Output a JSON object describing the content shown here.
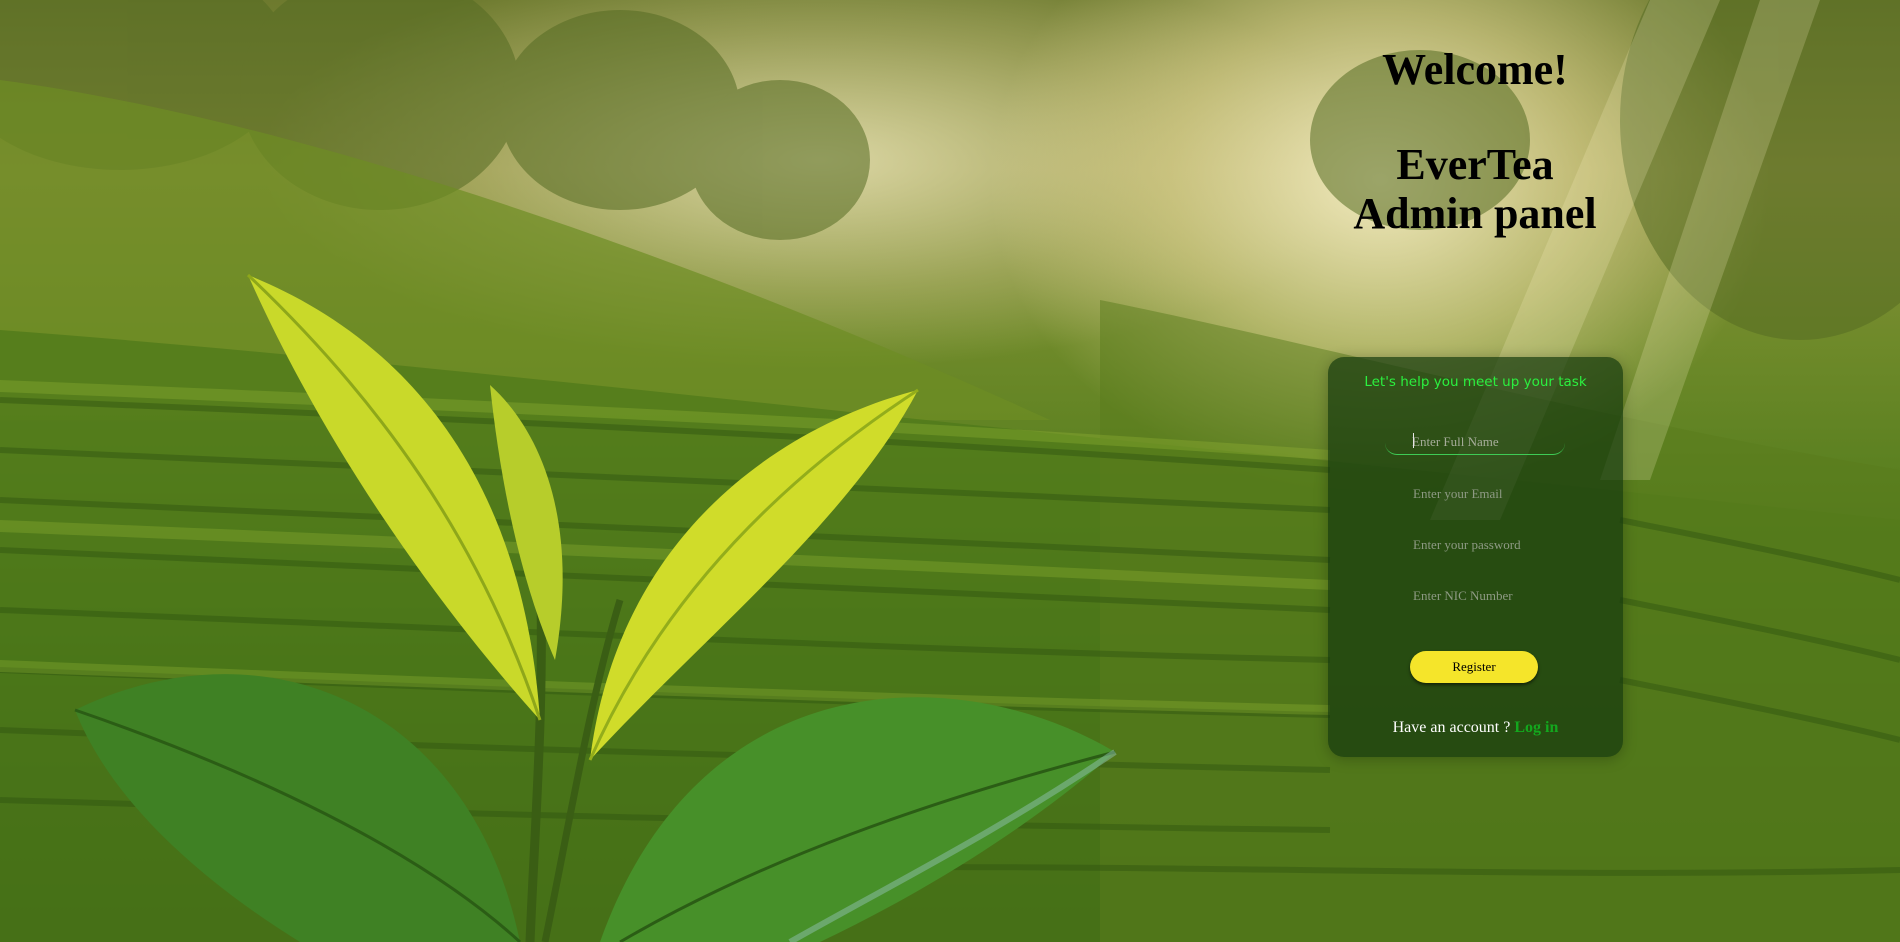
{
  "header": {
    "welcome": "Welcome!",
    "brand": "EverTea",
    "subtitle": "Admin panel"
  },
  "form": {
    "tagline": "Let's help you meet up your task",
    "full_name_placeholder": "Enter Full Name",
    "email_placeholder": "Enter your Email",
    "password_placeholder": "Enter your password",
    "nic_placeholder": "Enter NIC Number",
    "register_label": "Register",
    "have_account_text": "Have an account ?",
    "login_label": "Log in"
  },
  "colors": {
    "tagline": "#2bf03f",
    "register_button": "#f5e52a",
    "login_link": "#13a81e",
    "card_background": "#163a0e"
  },
  "background": {
    "icon": "tea-plantation-image"
  }
}
